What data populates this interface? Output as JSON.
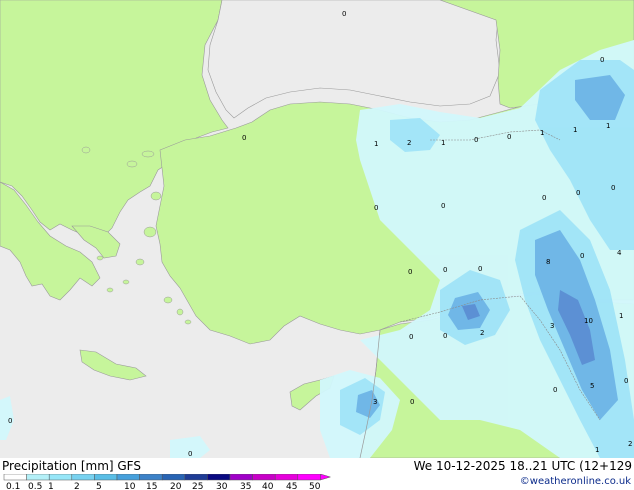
{
  "header": {
    "left_label": "Precipitation [mm]  GFS",
    "right_label": "We 10-12-2025 18..21 UTC (12+129",
    "credit": "©weatheronline.co.uk"
  },
  "legend": {
    "ticks": [
      "0.1",
      "0.5",
      "1",
      "2",
      "5",
      "10",
      "15",
      "20",
      "25",
      "30",
      "35",
      "40",
      "45",
      "50"
    ],
    "colors": [
      "#ffffff",
      "#b4f0f8",
      "#96e6f8",
      "#78d2f0",
      "#5abee6",
      "#46a0dc",
      "#3c82c8",
      "#2864b4",
      "#1e3c96",
      "#0a0a82",
      "#a000c8",
      "#c800c8",
      "#e600dc",
      "#ff00ff"
    ]
  },
  "colors": {
    "land": "#c6f59b",
    "sea": "#ececec",
    "precip_light": "#d2f8fc",
    "precip_mid": "#a0e4f8",
    "precip_heavy": "#6eb4e6",
    "precip_core": "#5a8cd2"
  },
  "map_values": [
    {
      "text": "0",
      "id": "v1"
    },
    {
      "text": "0",
      "id": "v2"
    },
    {
      "text": "0",
      "id": "v3"
    },
    {
      "text": "1",
      "id": "v4"
    },
    {
      "text": "2",
      "id": "v5"
    },
    {
      "text": "1",
      "id": "v6"
    },
    {
      "text": "0",
      "id": "v7"
    },
    {
      "text": "0",
      "id": "v8"
    },
    {
      "text": "1",
      "id": "v9"
    },
    {
      "text": "1",
      "id": "v10"
    },
    {
      "text": "1",
      "id": "v11"
    },
    {
      "text": "0",
      "id": "v12"
    },
    {
      "text": "0",
      "id": "v13"
    },
    {
      "text": "0",
      "id": "v14"
    },
    {
      "text": "0",
      "id": "v15"
    },
    {
      "text": "0",
      "id": "v16"
    },
    {
      "text": "0",
      "id": "v17"
    },
    {
      "text": "0",
      "id": "v18"
    },
    {
      "text": "8",
      "id": "v19"
    },
    {
      "text": "0",
      "id": "v20"
    },
    {
      "text": "4",
      "id": "v21"
    },
    {
      "text": "0",
      "id": "v22"
    },
    {
      "text": "0",
      "id": "v23"
    },
    {
      "text": "2",
      "id": "v24"
    },
    {
      "text": "3",
      "id": "v25"
    },
    {
      "text": "10",
      "id": "v26"
    },
    {
      "text": "1",
      "id": "v27"
    },
    {
      "text": "0",
      "id": "v28"
    },
    {
      "text": "5",
      "id": "v29"
    },
    {
      "text": "0",
      "id": "v30"
    },
    {
      "text": "3",
      "id": "v31"
    },
    {
      "text": "0",
      "id": "v32"
    },
    {
      "text": "1",
      "id": "v33"
    },
    {
      "text": "2",
      "id": "v34"
    },
    {
      "text": "0",
      "id": "v35"
    },
    {
      "text": "0",
      "id": "v36"
    },
    {
      "text": "0",
      "id": "v37"
    }
  ]
}
